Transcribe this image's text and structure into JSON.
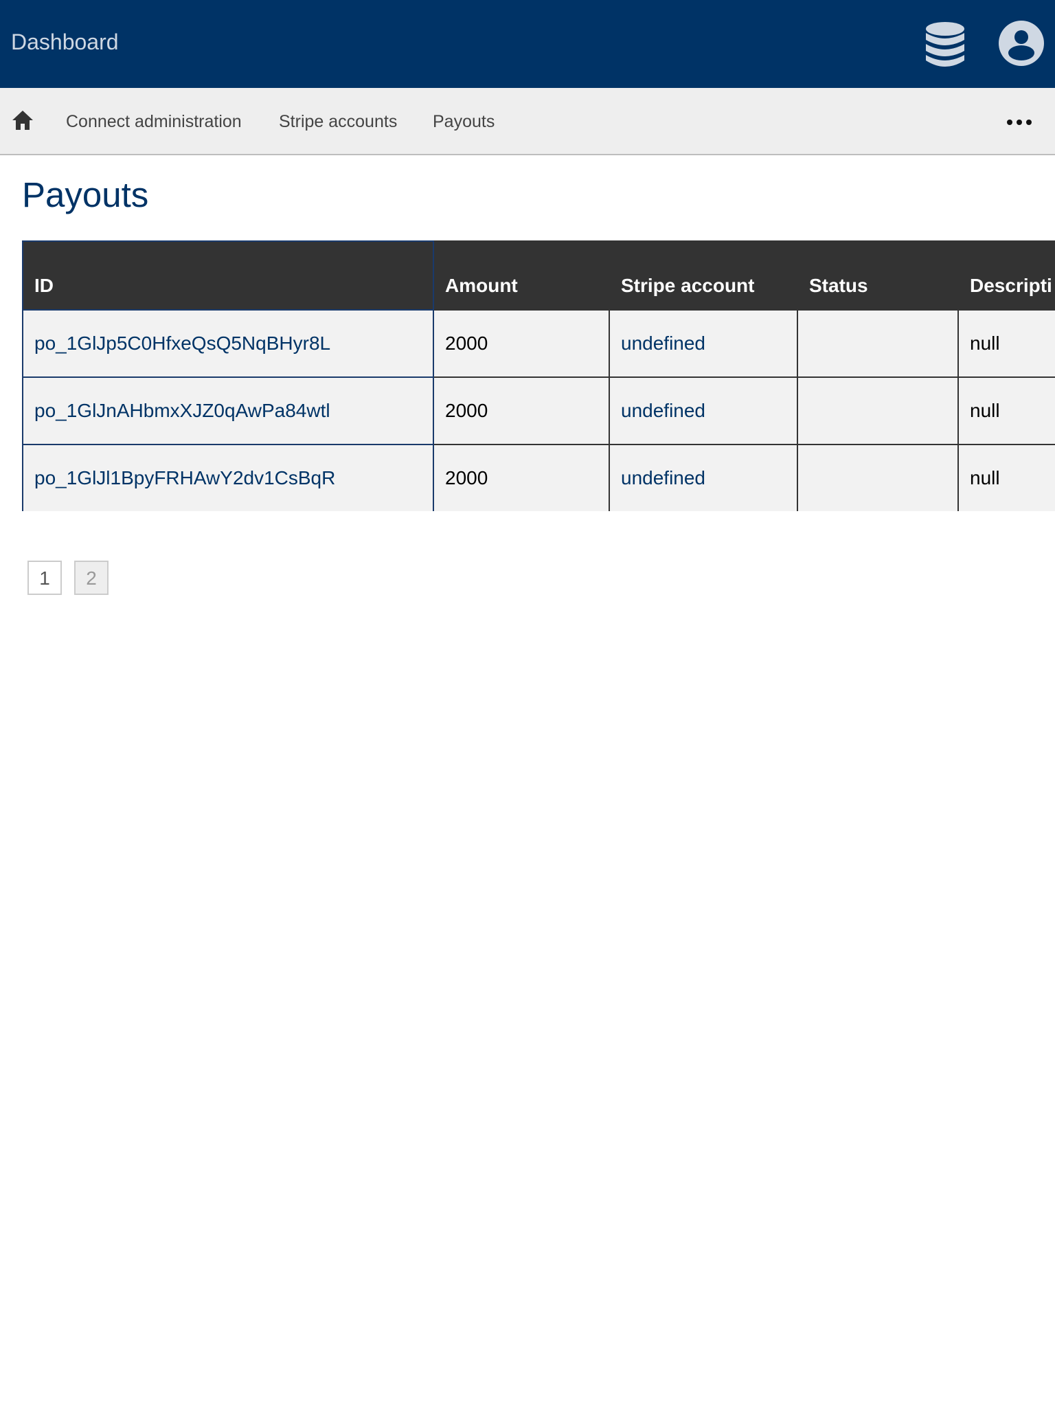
{
  "header": {
    "title": "Dashboard",
    "icons": [
      "database-icon",
      "user-account-icon"
    ],
    "colors": {
      "background": "#003366",
      "text": "#cfd8e3"
    }
  },
  "nav": {
    "home_icon": "home-icon",
    "items": [
      {
        "label": "Connect administration"
      },
      {
        "label": "Stripe accounts"
      },
      {
        "label": "Payouts"
      }
    ],
    "more_icon": "more-horizontal-icon"
  },
  "page": {
    "title": "Payouts"
  },
  "table": {
    "columns": [
      "ID",
      "Amount",
      "Stripe account",
      "Status",
      "Descripti"
    ],
    "rows": [
      {
        "id": "po_1GlJp5C0HfxeQsQ5NqBHyr8L",
        "amount": "2000",
        "stripe_account": "undefined",
        "status": "",
        "description": "null"
      },
      {
        "id": "po_1GlJnAHbmxXJZ0qAwPa84wtl",
        "amount": "2000",
        "stripe_account": "undefined",
        "status": "",
        "description": "null"
      },
      {
        "id": "po_1GlJl1BpyFRHAwY2dv1CsBqR",
        "amount": "2000",
        "stripe_account": "undefined",
        "status": "",
        "description": "null"
      }
    ]
  },
  "pagination": {
    "pages": [
      "1",
      "2"
    ],
    "current": "2"
  },
  "colors": {
    "accent": "#003366",
    "table_header_bg": "#333333",
    "row_bg": "#f2f2f2",
    "nav_bg": "#eeeeee"
  }
}
